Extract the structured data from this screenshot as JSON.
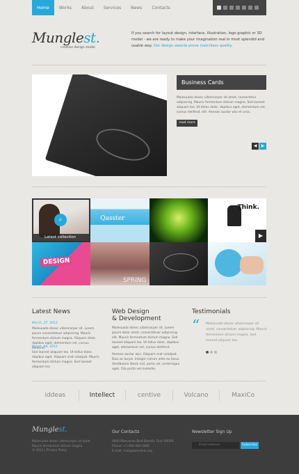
{
  "nav": {
    "items": [
      {
        "label": "Home",
        "active": true
      },
      {
        "label": "Works"
      },
      {
        "label": "About"
      },
      {
        "label": "Services"
      },
      {
        "label": "News"
      },
      {
        "label": "Contacts"
      }
    ]
  },
  "social": {
    "icons": [
      "facebook-icon",
      "twitter-icon",
      "rss-icon",
      "delicious-icon",
      "flickr-icon",
      "digg-icon",
      "myspace-icon"
    ]
  },
  "header": {
    "logo_main": "Mungle",
    "logo_accent": "st.",
    "tagline": "creative design studio",
    "intro": "If you search for layout design, interface, illustration, logo graphic or 3D model - we are ready to make your imagination real in most splendid and usable way.",
    "intro_highlight": "Our design awards prove matchless quality."
  },
  "slider": {
    "title": "Business Cards",
    "text": "Malesuada donec ullamcorper sit amet, consectetur adipiscing. Mauris fermentum dictum magna. Sed laoreet aliquam leo. Ut tellus dolor, dapibus eget, elementum vel, cursus eleifend, elit. Aenean auctor wisi et urna.",
    "more_label": "read more",
    "prev": "◀",
    "next": "▶"
  },
  "gallery": {
    "caption": "Latest collection",
    "tile2": "Qasster",
    "tile4": "Think.",
    "tile5": "DESIGN",
    "tile6": "SPRING"
  },
  "news": {
    "title": "Latest News",
    "items": [
      {
        "date": "March, 27, 2012",
        "text": "Malesuada donec ullamcorper sit. Lorem ipsum consectetuer adipiscing. Mauris fermentum dictum magna. Aliquam dolor, dapibus eget, elementum vel, cursus eleifend."
      },
      {
        "date": "March, 09, 2012",
        "text": "Sed laoreet aliquam leo. Ut tellus dolor, dapibus eget. Aliquam erat volutpat. Mauris fermentum dictum magna. Sed laoreet aliquam leo."
      }
    ]
  },
  "web": {
    "title_line1": "Web Design",
    "title_line2": "& Development",
    "p1": "Malesuada donec ullamcorper sit. Lorem ipsum dolor amet, consectetuer adipiscing elit. Mauris fermentum dictum magna. Sed laoreet aliquam leo. Ut tellus dolor, dapibus eget, elementum vel, cursus eleifend.",
    "p2": "Aenean auctor wisi. Aliquam erat volutpat. Duis ac turpis. Integer rutrum ante eu lacus. Vestibulum libero nisl, porta vel, scelerisque eget. Cilo porta vel molestie."
  },
  "testimonials": {
    "title": "Testimonials",
    "quote_mark": "“",
    "text": "Malesuada donec ullamcorper sit amet, consectetuer adipiscing. Mauris fermentum dictum magna. Sed laoreet aliquam leo."
  },
  "partners": [
    "iddeas",
    "Intellect",
    "centive",
    "Volcano",
    "MaxiCo"
  ],
  "footer": {
    "logo_main": "Mungle",
    "logo_accent": "st.",
    "about": "Malesuada donec ullamcorper sit amet. Mauris fermentum dictum magna.",
    "copyright": "© 2012 | Privacy Policy",
    "contacts_title": "Our Contacts",
    "address": "0000 Maecenas Blvd Blandit, Duis 00000",
    "phone": "Phone: +1 000 000 0000",
    "email": "E-mail: mail@demolink.org",
    "newsletter_title": "Newsletter Sign Up",
    "email_placeholder": "Email address",
    "subscribe_label": "Subscribe"
  },
  "colors": {
    "accent": "#28a8d8",
    "dark": "#3d3d3d",
    "background": "#e9e8e4"
  }
}
